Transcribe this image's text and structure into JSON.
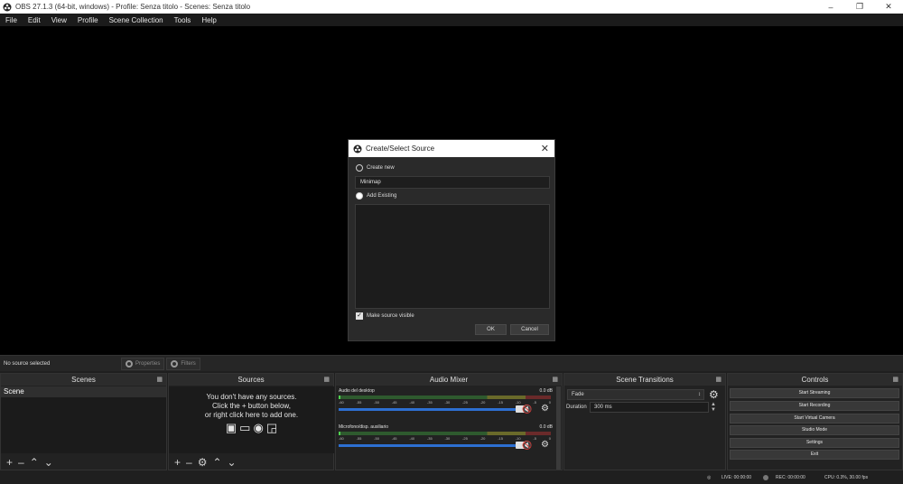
{
  "window": {
    "title": "OBS 27.1.3 (64-bit, windows) - Profile: Senza titolo - Scenes: Senza titolo"
  },
  "menu": [
    "File",
    "Edit",
    "View",
    "Profile",
    "Scene Collection",
    "Tools",
    "Help"
  ],
  "dialog": {
    "title": "Create/Select Source",
    "create_new_label": "Create new",
    "name_value": "Minimap",
    "add_existing_label": "Add Existing",
    "make_visible_label": "Make source visible",
    "make_visible_checked": true,
    "ok_label": "OK",
    "cancel_label": "Cancel"
  },
  "toolbar": {
    "no_source": "No source selected",
    "properties": "Properties",
    "filters": "Filters"
  },
  "scenes": {
    "title": "Scenes",
    "items": [
      "Scene"
    ]
  },
  "sources": {
    "title": "Sources",
    "empty_line1": "You don't have any sources.",
    "empty_line2": "Click the + button below,",
    "empty_line3": "or right click here to add one."
  },
  "mixer": {
    "title": "Audio Mixer",
    "channels": [
      {
        "name": "Audio del desktop",
        "db": "0.0 dB"
      },
      {
        "name": "Microfono/disp. ausiliario",
        "db": "0.0 dB"
      }
    ],
    "ticks": [
      "-60",
      "-55",
      "-50",
      "-45",
      "-40",
      "-35",
      "-30",
      "-25",
      "-20",
      "-15",
      "-10",
      "-5",
      "0"
    ]
  },
  "transitions": {
    "title": "Scene Transitions",
    "selected": "Fade",
    "duration_label": "Duration",
    "duration_value": "300 ms"
  },
  "controls": {
    "title": "Controls",
    "buttons": [
      "Start Streaming",
      "Start Recording",
      "Start Virtual Camera",
      "Studio Mode",
      "Settings",
      "Exit"
    ]
  },
  "status": {
    "live": "LIVE: 00:00:00",
    "rec": "REC: 00:00:00",
    "perf": "CPU: 0.3%, 30.00 fps"
  }
}
